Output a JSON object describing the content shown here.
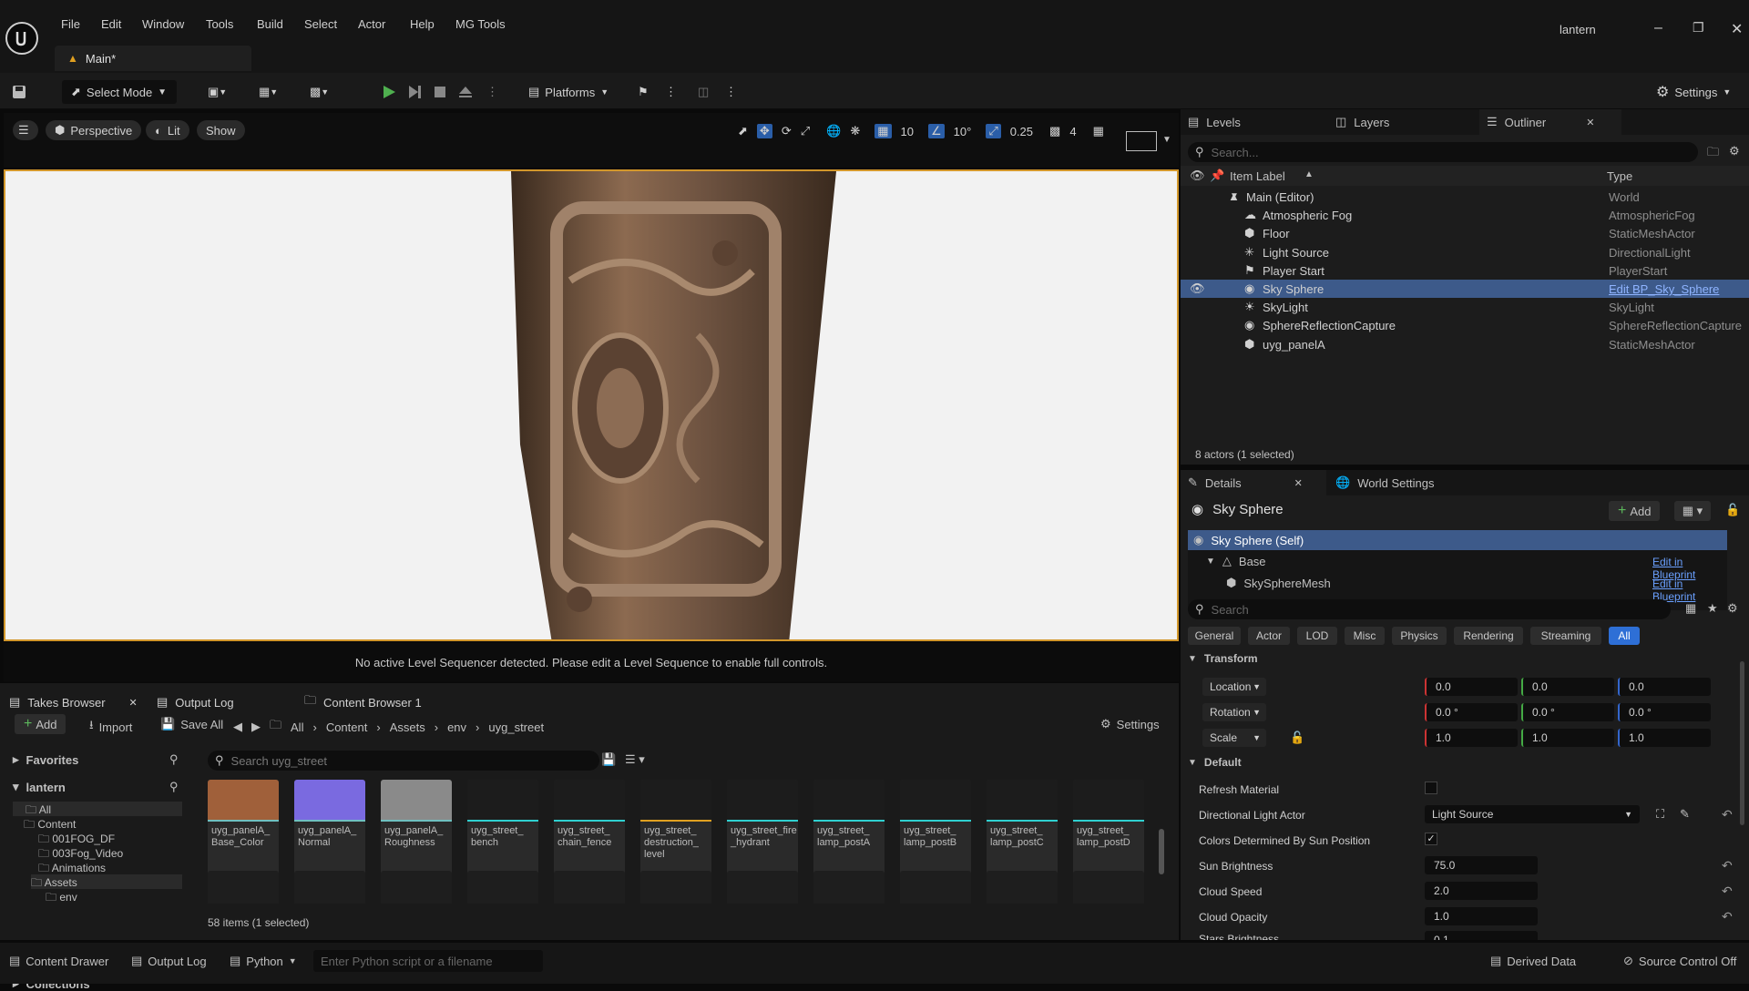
{
  "menubar": {
    "items": [
      "File",
      "Edit",
      "Window",
      "Tools",
      "Build",
      "Select",
      "Actor",
      "Help",
      "MG Tools"
    ],
    "project": "lantern",
    "tab": "Main*"
  },
  "toolbar": {
    "select_mode": "Select Mode",
    "platforms": "Platforms",
    "settings": "Settings"
  },
  "viewport": {
    "perspective": "Perspective",
    "lit": "Lit",
    "show": "Show",
    "grid": "10",
    "angle": "10°",
    "scale": "0.25",
    "camera": "4",
    "message": "No active Level Sequencer detected. Please edit a Level Sequence to enable full controls."
  },
  "panels_top": {
    "levels": "Levels",
    "layers": "Layers",
    "outliner": "Outliner"
  },
  "outliner": {
    "search_placeholder": "Search...",
    "col_label": "Item Label",
    "col_type": "Type",
    "rows": [
      {
        "label": "Main (Editor)",
        "type": "World"
      },
      {
        "label": "Atmospheric Fog",
        "type": "AtmosphericFog"
      },
      {
        "label": "Floor",
        "type": "StaticMeshActor"
      },
      {
        "label": "Light Source",
        "type": "DirectionalLight"
      },
      {
        "label": "Player Start",
        "type": "PlayerStart"
      },
      {
        "label": "Sky Sphere",
        "type": "Edit BP_Sky_Sphere"
      },
      {
        "label": "SkyLight",
        "type": "SkyLight"
      },
      {
        "label": "SphereReflectionCapture",
        "type": "SphereReflectionCapture"
      },
      {
        "label": "uyg_panelA",
        "type": "StaticMeshActor"
      }
    ],
    "count": "8 actors (1 selected)"
  },
  "details": {
    "tab": "Details",
    "world_tab": "World Settings",
    "title": "Sky Sphere",
    "add": "Add",
    "self": "Sky Sphere (Self)",
    "base": "Base",
    "mesh": "SkySphereMesh",
    "edit_bp": "Edit in Blueprint",
    "search_placeholder": "Search",
    "filters": [
      "General",
      "Actor",
      "LOD",
      "Misc",
      "Physics",
      "Rendering",
      "Streaming",
      "All"
    ],
    "transform": "Transform",
    "location": "Location",
    "rotation": "Rotation",
    "scale": "Scale",
    "loc": [
      "0.0",
      "0.0",
      "0.0"
    ],
    "rot": [
      "0.0 °",
      "0.0 °",
      "0.0 °"
    ],
    "scl": [
      "1.0",
      "1.0",
      "1.0"
    ],
    "default": "Default",
    "refresh": "Refresh Material",
    "dir_light": "Directional Light Actor",
    "dir_light_val": "Light Source",
    "colors_sun": "Colors Determined By Sun Position",
    "sun_brightness": "Sun Brightness",
    "sun_brightness_val": "75.0",
    "cloud_speed": "Cloud Speed",
    "cloud_speed_val": "2.0",
    "cloud_opacity": "Cloud Opacity",
    "cloud_opacity_val": "1.0",
    "stars_brightness": "Stars Brightness",
    "stars_val": "0.1"
  },
  "browser": {
    "tabs": [
      "Takes Browser",
      "Output Log",
      "Content Browser 1"
    ],
    "add": "Add",
    "import": "Import",
    "save_all": "Save All",
    "settings": "Settings",
    "path": [
      "All",
      "Content",
      "Assets",
      "env",
      "uyg_street"
    ],
    "favorites": "Favorites",
    "project": "lantern",
    "collections": "Collections",
    "tree": [
      "All",
      "Content",
      "001FOG_DF",
      "003Fog_Video",
      "Animations",
      "Assets",
      "env"
    ],
    "search_placeholder": "Search uyg_street",
    "items": [
      {
        "name": "uyg_panelA_ Base_Color",
        "color": "#6fc0c0"
      },
      {
        "name": "uyg_panelA_ Normal",
        "color": "#6fc0c0"
      },
      {
        "name": "uyg_panelA_ Roughness",
        "color": "#6fc0c0"
      },
      {
        "name": "uyg_street_ bench",
        "color": "#2fd0d0"
      },
      {
        "name": "uyg_street_ chain_fence",
        "color": "#2fd0d0"
      },
      {
        "name": "uyg_street_ destruction_ level",
        "color": "#e0a020"
      },
      {
        "name": "uyg_street_fire _hydrant",
        "color": "#2fd0d0"
      },
      {
        "name": "uyg_street_ lamp_postA",
        "color": "#2fd0d0"
      },
      {
        "name": "uyg_street_ lamp_postB",
        "color": "#2fd0d0"
      },
      {
        "name": "uyg_street_ lamp_postC",
        "color": "#2fd0d0"
      },
      {
        "name": "uyg_street_ lamp_postD",
        "color": "#2fd0d0"
      }
    ],
    "count": "58 items (1 selected)"
  },
  "status": {
    "drawer": "Content Drawer",
    "output": "Output Log",
    "python": "Python",
    "cmd_placeholder": "Enter Python script or a filename",
    "derived": "Derived Data",
    "source": "Source Control Off"
  }
}
